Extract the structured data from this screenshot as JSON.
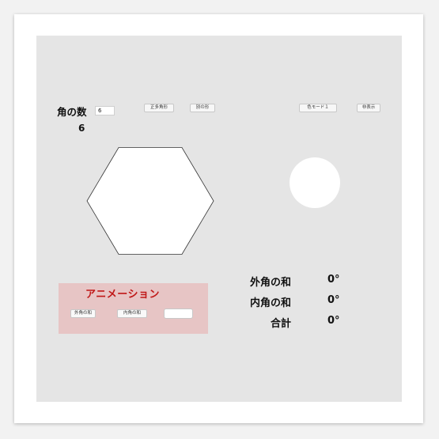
{
  "controls": {
    "sides_label": "角の数",
    "sides_input_value": "6",
    "sides_count": "6",
    "regular_polygon_button": "正多角形",
    "other_shape_button": "別の形",
    "color_mode_button": "色モード１",
    "hide_button": "非表示"
  },
  "shape": {
    "sides": 6,
    "fill": "#ffffff",
    "stroke": "#333333"
  },
  "animation": {
    "title": "アニメーション",
    "exterior_button": "外角の和",
    "interior_button": "内角の和",
    "blank_button": ""
  },
  "sums": {
    "exterior_label": "外角の和",
    "exterior_value": "0°",
    "interior_label": "内角の和",
    "interior_value": "0°",
    "total_label": "合計",
    "total_value": "0°"
  },
  "colors": {
    "stage_background": "#e5e5e5",
    "animation_panel": "#e7c5c5",
    "animation_title": "#c01818"
  }
}
